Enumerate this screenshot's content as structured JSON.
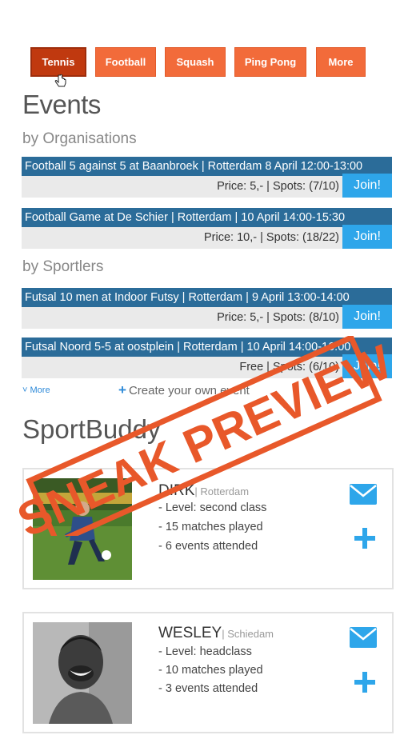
{
  "tabs": [
    "Tennis",
    "Football",
    "Squash",
    "Ping Pong",
    "More"
  ],
  "active_tab": "Tennis",
  "events_title": "Events",
  "by_organisations": "by Organisations",
  "by_sportlers": "by Sportlers",
  "events": [
    {
      "title": "Football 5 against 5 at Baanbroek | Rotterdam 8 April 12:00-13:00",
      "price": "Price: 5,- | Spots: (7/10)",
      "join": "Join!"
    },
    {
      "title": "Football Game at De Schier | Rotterdam | 10 April 14:00-15:30",
      "price": "Price: 10,- | Spots: (18/22)",
      "join": "Join!"
    },
    {
      "title": "Futsal 10 men at Indoor Futsy | Rotterdam | 9 April 13:00-14:00",
      "price": "Price: 5,- | Spots: (8/10)",
      "join": "Join!"
    },
    {
      "title": "Futsal Noord 5-5 at oostplein | Rotterdam | 10 April 14:00-16:00",
      "price": "Free | Spots: (6/10)",
      "join": "Join!"
    }
  ],
  "more_label": "More",
  "create_label": "Create your own event",
  "sportbuddy_title": "SportBuddy",
  "buddies": [
    {
      "name": "DIRK",
      "city": "| Rotterdam",
      "level": "- Level: second class",
      "matches": "- 15 matches played",
      "events": "- 6 events attended"
    },
    {
      "name": "WESLEY",
      "city": "| Schiedam",
      "level": "- Level: headclass",
      "matches": "- 10 matches played",
      "events": "- 3 events attended"
    }
  ],
  "stamp_text": "SNEAK PREVIEW",
  "colors": {
    "tab": "#f26b3a",
    "tab_active": "#c0390f",
    "event_bar": "#2b6c99",
    "join": "#2ea6ea",
    "stamp": "#e8582a"
  }
}
